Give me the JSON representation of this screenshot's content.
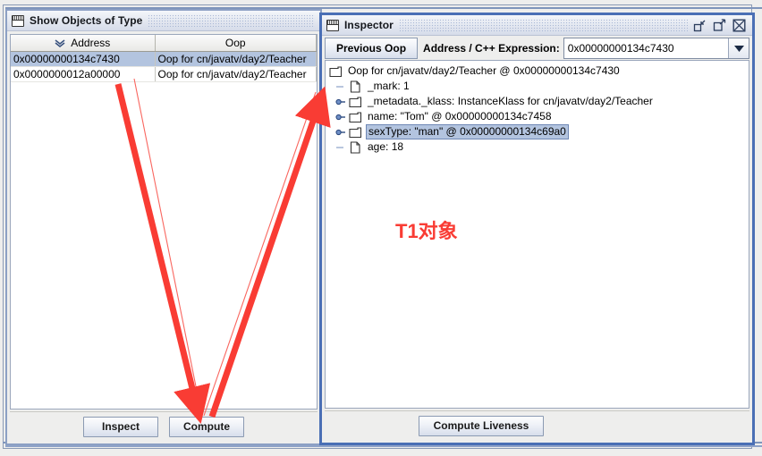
{
  "windows": {
    "objects_window": {
      "title": "Show Objects of Type",
      "icon": "window-icon",
      "table": {
        "columns": [
          "Address",
          "Oop"
        ],
        "sorted_column": "Address",
        "sort_icon": "sort-descending-icon",
        "rows": [
          {
            "address": "0x00000000134c7430",
            "oop": "Oop for cn/javatv/day2/Teacher",
            "selected": true
          },
          {
            "address": "0x0000000012a00000",
            "oop": "Oop for cn/javatv/day2/Teacher",
            "selected": false
          }
        ]
      },
      "buttons": [
        {
          "label": "Inspect",
          "name": "inspect-button"
        },
        {
          "label": "Compute",
          "name": "compute-button"
        }
      ]
    },
    "inspector_window": {
      "title": "Inspector",
      "icon": "window-icon",
      "title_buttons": [
        {
          "name": "minimize-button",
          "icon": "minimize-icon"
        },
        {
          "name": "maximize-button",
          "icon": "maximize-icon"
        },
        {
          "name": "close-button",
          "icon": "close-icon"
        }
      ],
      "toolbar": {
        "previous_oop_label": "Previous Oop",
        "expression_label": "Address / C++ Expression:",
        "expression_value": "0x00000000134c7430",
        "dropdown_icon": "chevron-down-icon"
      },
      "tree": [
        {
          "depth": 0,
          "icon": "folder-icon",
          "handle": "none",
          "label": "Oop for cn/javatv/day2/Teacher @ 0x00000000134c7430",
          "selected": false
        },
        {
          "depth": 1,
          "icon": "file-icon",
          "handle": "leaf",
          "label": "_mark: 1",
          "selected": false
        },
        {
          "depth": 1,
          "icon": "folder-icon",
          "handle": "expand",
          "label": "_metadata._klass: InstanceKlass for cn/javatv/day2/Teacher",
          "selected": false
        },
        {
          "depth": 1,
          "icon": "folder-icon",
          "handle": "expand",
          "label": "name: \"Tom\" @ 0x00000000134c7458",
          "selected": false
        },
        {
          "depth": 1,
          "icon": "folder-icon",
          "handle": "expand",
          "label": "sexType: \"man\" @ 0x00000000134c69a0",
          "selected": true
        },
        {
          "depth": 1,
          "icon": "file-icon",
          "handle": "leaf",
          "label": "age: 18",
          "selected": false
        }
      ],
      "buttons": [
        {
          "label": "Compute Liveness",
          "name": "compute-liveness-button"
        }
      ]
    }
  },
  "annotations": {
    "label": "T1对象",
    "color": "#f93c34"
  },
  "colors": {
    "selection": "#b3c4df",
    "active_window_border": "#4a6fb5",
    "inactive_window_border": "#8ca0c4",
    "annotation_red": "#f93c34"
  }
}
